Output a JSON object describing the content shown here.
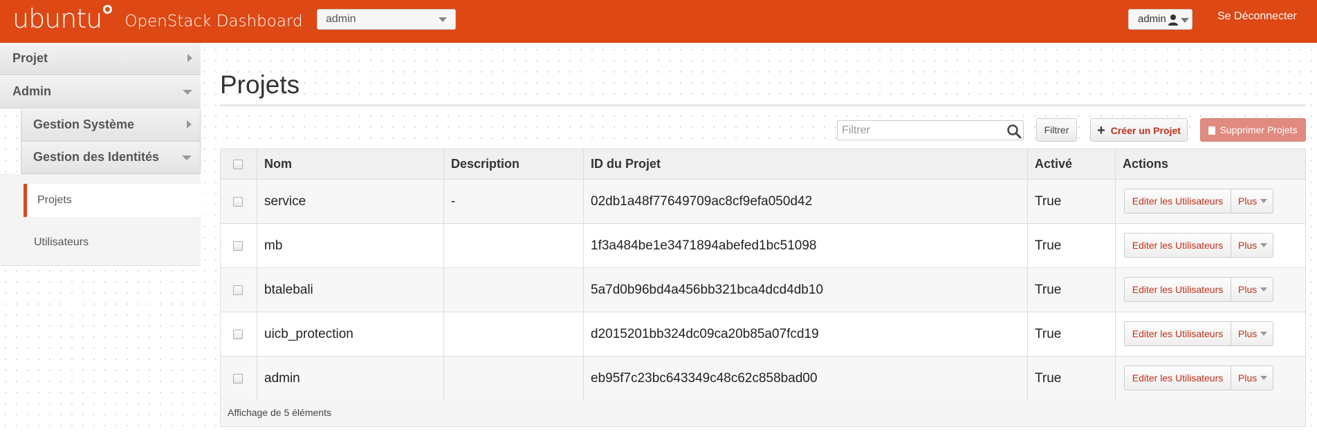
{
  "brand": {
    "logo_text": "ubuntu",
    "title": "OpenStack Dashboard"
  },
  "header": {
    "project_selector": "admin",
    "user_menu": "admin",
    "signout": "Se Déconnecter"
  },
  "sidebar": {
    "projet": "Projet",
    "admin": "Admin",
    "gestion_systeme": "Gestion Système",
    "gestion_identites": "Gestion des Identités",
    "items": [
      {
        "label": "Projets",
        "active": true
      },
      {
        "label": "Utilisateurs",
        "active": false
      }
    ]
  },
  "page": {
    "title": "Projets"
  },
  "toolbar": {
    "filter_placeholder": "Filtrer",
    "filter_button": "Filtrer",
    "create_button": "Créer un Projet",
    "delete_button": "Supprimer Projets"
  },
  "table": {
    "columns": [
      "Nom",
      "Description",
      "ID du Projet",
      "Activé",
      "Actions"
    ],
    "rows": [
      {
        "name": "service",
        "description": "-",
        "id": "02db1a48f77649709ac8cf9efa050d42",
        "enabled": "True"
      },
      {
        "name": "mb",
        "description": "",
        "id": "1f3a484be1e3471894abefed1bc51098",
        "enabled": "True"
      },
      {
        "name": "btalebali",
        "description": "",
        "id": "5a7d0b96bd4a456bb321bca4dcd4db10",
        "enabled": "True"
      },
      {
        "name": "uicb_protection",
        "description": "",
        "id": "d2015201bb324dc09ca20b85a07fcd19",
        "enabled": "True"
      },
      {
        "name": "admin",
        "description": "",
        "id": "eb95f7c23bc643349c48c62c858bad00",
        "enabled": "True"
      }
    ],
    "action_edit": "Editer les Utilisateurs",
    "action_more": "Plus",
    "footer": "Affichage de 5 éléments"
  },
  "colors": {
    "accent": "#dd4814",
    "danger_button": "#e08a80",
    "link_red": "#c0301a"
  },
  "icons": [
    "ubuntu-logo-icon",
    "user-icon",
    "search-icon",
    "plus-icon",
    "trash-icon",
    "chevron-right-icon",
    "chevron-down-icon"
  ]
}
